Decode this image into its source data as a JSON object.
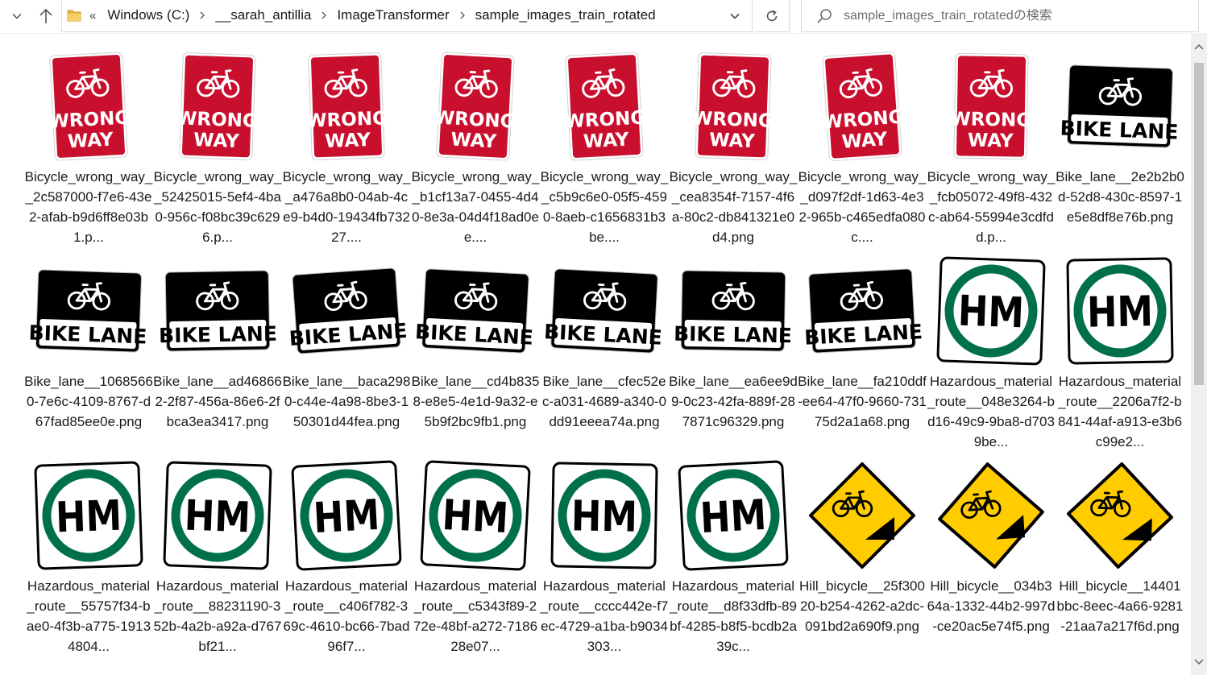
{
  "nav": {
    "back_icon": "arrow-left-icon",
    "forward_icon": "arrow-right-icon",
    "dropdown_icon": "chevron-down-icon",
    "up_icon": "arrow-up-icon"
  },
  "address": {
    "overflow": "«",
    "breadcrumbs": [
      "Windows (C:)",
      "__sarah_antillia",
      "ImageTransformer",
      "sample_images_train_rotated"
    ]
  },
  "search": {
    "placeholder": "sample_images_train_rotatedの検索"
  },
  "colors": {
    "wrong_way_red": "#c8102e",
    "bike_lane_black": "#000000",
    "hm_green": "#00704a",
    "hill_yellow": "#ffcc00"
  },
  "files": [
    {
      "name": "Bicycle_wrong_way__2c587000-f7e6-43e2-afab-b9d6ff8e03b1.p...",
      "sign": "wrong-way",
      "rotation": -3
    },
    {
      "name": "Bicycle_wrong_way__52425015-5ef4-4ba0-956c-f08bc39c6296.p...",
      "sign": "wrong-way",
      "rotation": 2
    },
    {
      "name": "Bicycle_wrong_way__a476a8b0-04ab-4ce9-b4d0-19434fb73227....",
      "sign": "wrong-way",
      "rotation": -2
    },
    {
      "name": "Bicycle_wrong_way__b1cf13a7-0455-4d40-8e3a-04d4f18ad0ee....",
      "sign": "wrong-way",
      "rotation": 3
    },
    {
      "name": "Bicycle_wrong_way__c5b9c6e0-05f5-4590-8aeb-c1656831b3be....",
      "sign": "wrong-way",
      "rotation": -3
    },
    {
      "name": "Bicycle_wrong_way__cea8354f-7157-4f6a-80c2-db841321e0d4.png",
      "sign": "wrong-way",
      "rotation": 2
    },
    {
      "name": "Bicycle_wrong_way__d097f2df-1d63-4e32-965b-c465edfa080c....",
      "sign": "wrong-way",
      "rotation": -4
    },
    {
      "name": "Bicycle_wrong_way__fcb05072-49f8-432c-ab64-55994e3cdfdd.p...",
      "sign": "wrong-way",
      "rotation": 1
    },
    {
      "name": "Bike_lane__2e2b2b0d-52d8-430c-8597-1e5e8df8e76b.png",
      "sign": "bike-lane",
      "rotation": 2
    },
    {
      "name": "Bike_lane__10685660-7e6c-4109-8767-d67fad85ee0e.png",
      "sign": "bike-lane",
      "rotation": 2
    },
    {
      "name": "Bike_lane__ad468662-2f87-456a-86e6-2fbca3ea3417.png",
      "sign": "bike-lane",
      "rotation": -1
    },
    {
      "name": "Bike_lane__baca2980-c44e-4a98-8be3-150301d44fea.png",
      "sign": "bike-lane",
      "rotation": -4
    },
    {
      "name": "Bike_lane__cd4b8358-e8e5-4e1d-9a32-e5b9f2bc9fb1.png",
      "sign": "bike-lane",
      "rotation": 3
    },
    {
      "name": "Bike_lane__cfec52ec-a031-4689-a340-0dd91eeea74a.png",
      "sign": "bike-lane",
      "rotation": 3
    },
    {
      "name": "Bike_lane__ea6ee9d9-0c23-42fa-889f-287871c96329.png",
      "sign": "bike-lane",
      "rotation": 1
    },
    {
      "name": "Bike_lane__fa210ddf-ee64-47f0-9660-73175d2a1a68.png",
      "sign": "bike-lane",
      "rotation": -3
    },
    {
      "name": "Hazardous_material_route__048e3264-bd16-49c9-9ba8-d7039be...",
      "sign": "hm",
      "rotation": 2
    },
    {
      "name": "Hazardous_material_route__2206a7f2-b841-44af-a913-e3b6c99e2...",
      "sign": "hm",
      "rotation": -1
    },
    {
      "name": "Hazardous_material_route__55757f34-bae0-4f3b-a775-19134804...",
      "sign": "hm",
      "rotation": -2
    },
    {
      "name": "Hazardous_material_route__88231190-352b-4a2b-a92a-d767bf21...",
      "sign": "hm",
      "rotation": 2
    },
    {
      "name": "Hazardous_material_route__c406f782-369c-4610-bc66-7bad96f7...",
      "sign": "hm",
      "rotation": -3
    },
    {
      "name": "Hazardous_material_route__c5343f89-272e-48bf-a272-718628e07...",
      "sign": "hm",
      "rotation": 3
    },
    {
      "name": "Hazardous_material_route__cccc442e-f7ec-4729-a1ba-b9034303...",
      "sign": "hm",
      "rotation": 1
    },
    {
      "name": "Hazardous_material_route__d8f33dfb-89bf-4285-b8f5-bcdb2a39c...",
      "sign": "hm",
      "rotation": -3
    },
    {
      "name": "Hill_bicycle__25f30020-b254-4262-a2dc-091bd2a690f9.png",
      "sign": "hill",
      "rotation": 0
    },
    {
      "name": "Hill_bicycle__034b364a-1332-44b2-997d-ce20ac5e74f5.png",
      "sign": "hill",
      "rotation": -4
    },
    {
      "name": "Hill_bicycle__14401bbc-8eec-4a66-9281-21aa7a217f6d.png",
      "sign": "hill",
      "rotation": 2
    }
  ]
}
